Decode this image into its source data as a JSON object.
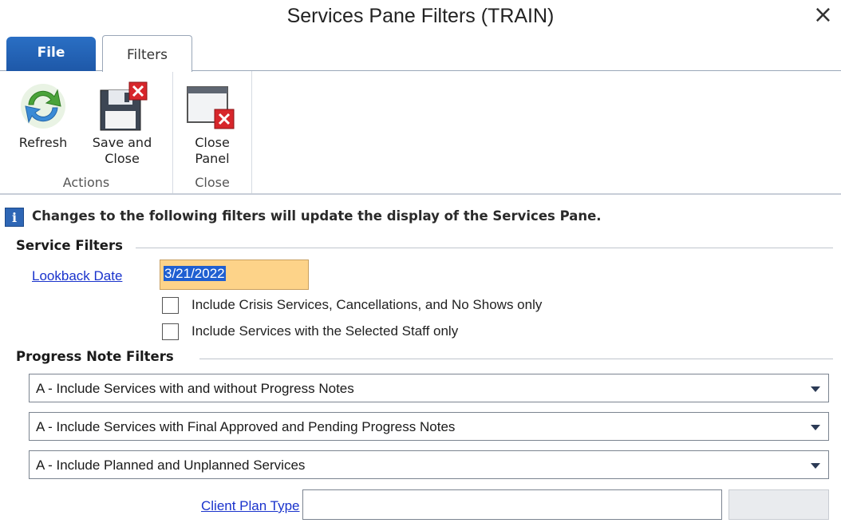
{
  "window": {
    "title": "Services Pane Filters (TRAIN)",
    "close_glyph": "×"
  },
  "tabs": [
    {
      "label": "File",
      "active": false
    },
    {
      "label": "Filters",
      "active": true
    }
  ],
  "ribbon": {
    "groups": [
      {
        "label": "Actions",
        "buttons": [
          {
            "label": "Refresh",
            "icon": "refresh-icon"
          },
          {
            "label_line1": "Save and",
            "label_line2": "Close",
            "icon": "save-close-icon"
          }
        ]
      },
      {
        "label": "Close",
        "buttons": [
          {
            "label_line1": "Close",
            "label_line2": "Panel",
            "icon": "close-panel-icon"
          }
        ]
      }
    ]
  },
  "info": {
    "icon": "info-icon",
    "icon_glyph": "i",
    "text": "Changes to the following filters will update the display of the Services Pane."
  },
  "service_filters": {
    "heading": "Service Filters",
    "lookback_label": "Lookback Date",
    "lookback_value": "3/21/2022",
    "checkboxes": [
      {
        "label": "Include Crisis Services, Cancellations, and No Shows only",
        "checked": false
      },
      {
        "label": "Include Services with the Selected Staff only",
        "checked": false
      }
    ]
  },
  "progress_note_filters": {
    "heading": "Progress Note Filters",
    "dropdowns": [
      {
        "value": "A - Include Services with and without Progress Notes"
      },
      {
        "value": "A - Include Services with Final Approved and Pending Progress Notes"
      },
      {
        "value": "A - Include Planned and Unplanned Services"
      }
    ],
    "client_plan_type_label": "Client Plan Type",
    "client_plan_type_value": ""
  },
  "colors": {
    "file_tab": "#1e58a8",
    "link": "#1a33cc",
    "date_highlight": "#fdd389",
    "selection": "#1f5fd1"
  }
}
